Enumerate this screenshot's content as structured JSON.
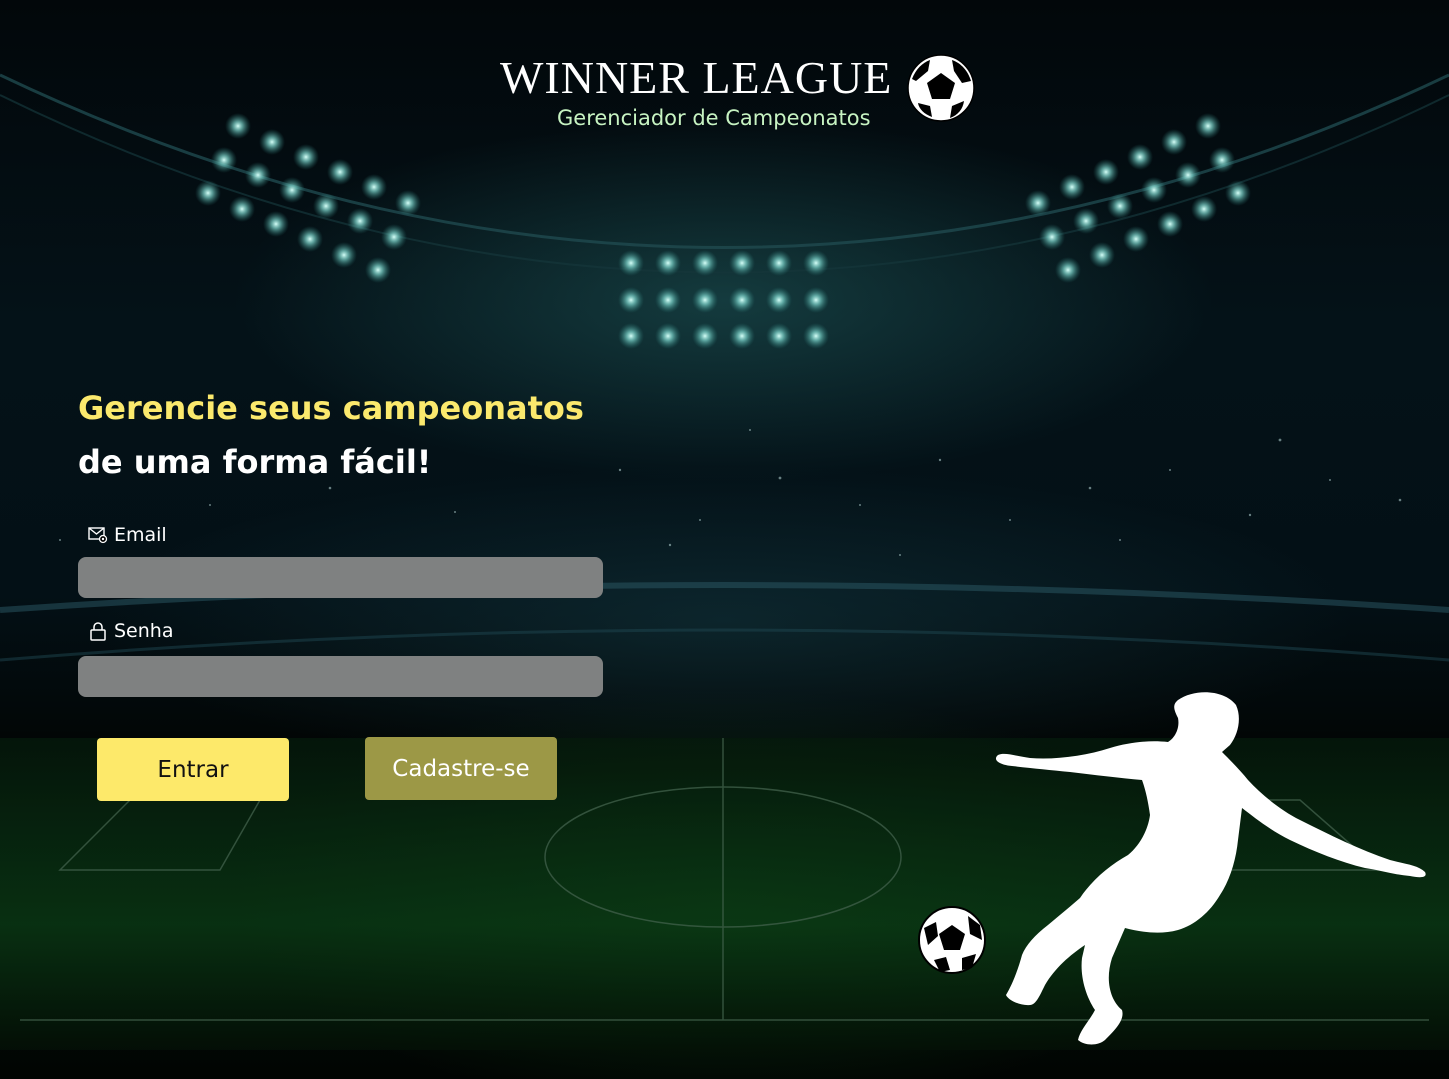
{
  "header": {
    "title": "WINNER LEAGUE",
    "subtitle": "Gerenciador de Campeonatos",
    "logo_icon": "soccer-ball-icon"
  },
  "hero": {
    "line1": "Gerencie seus campeonatos",
    "line2": "de uma forma fácil!"
  },
  "form": {
    "email": {
      "label": "Email",
      "icon": "email-icon",
      "value": "",
      "placeholder": ""
    },
    "senha": {
      "label": "Senha",
      "icon": "lock-icon",
      "value": "",
      "placeholder": ""
    }
  },
  "actions": {
    "login_label": "Entrar",
    "signup_label": "Cadastre-se"
  },
  "colors": {
    "accent_yellow": "#fde96a",
    "signup_olive": "#9c9846",
    "subtitle_green": "#c7f3c2",
    "input_gray": "#7f8181"
  }
}
